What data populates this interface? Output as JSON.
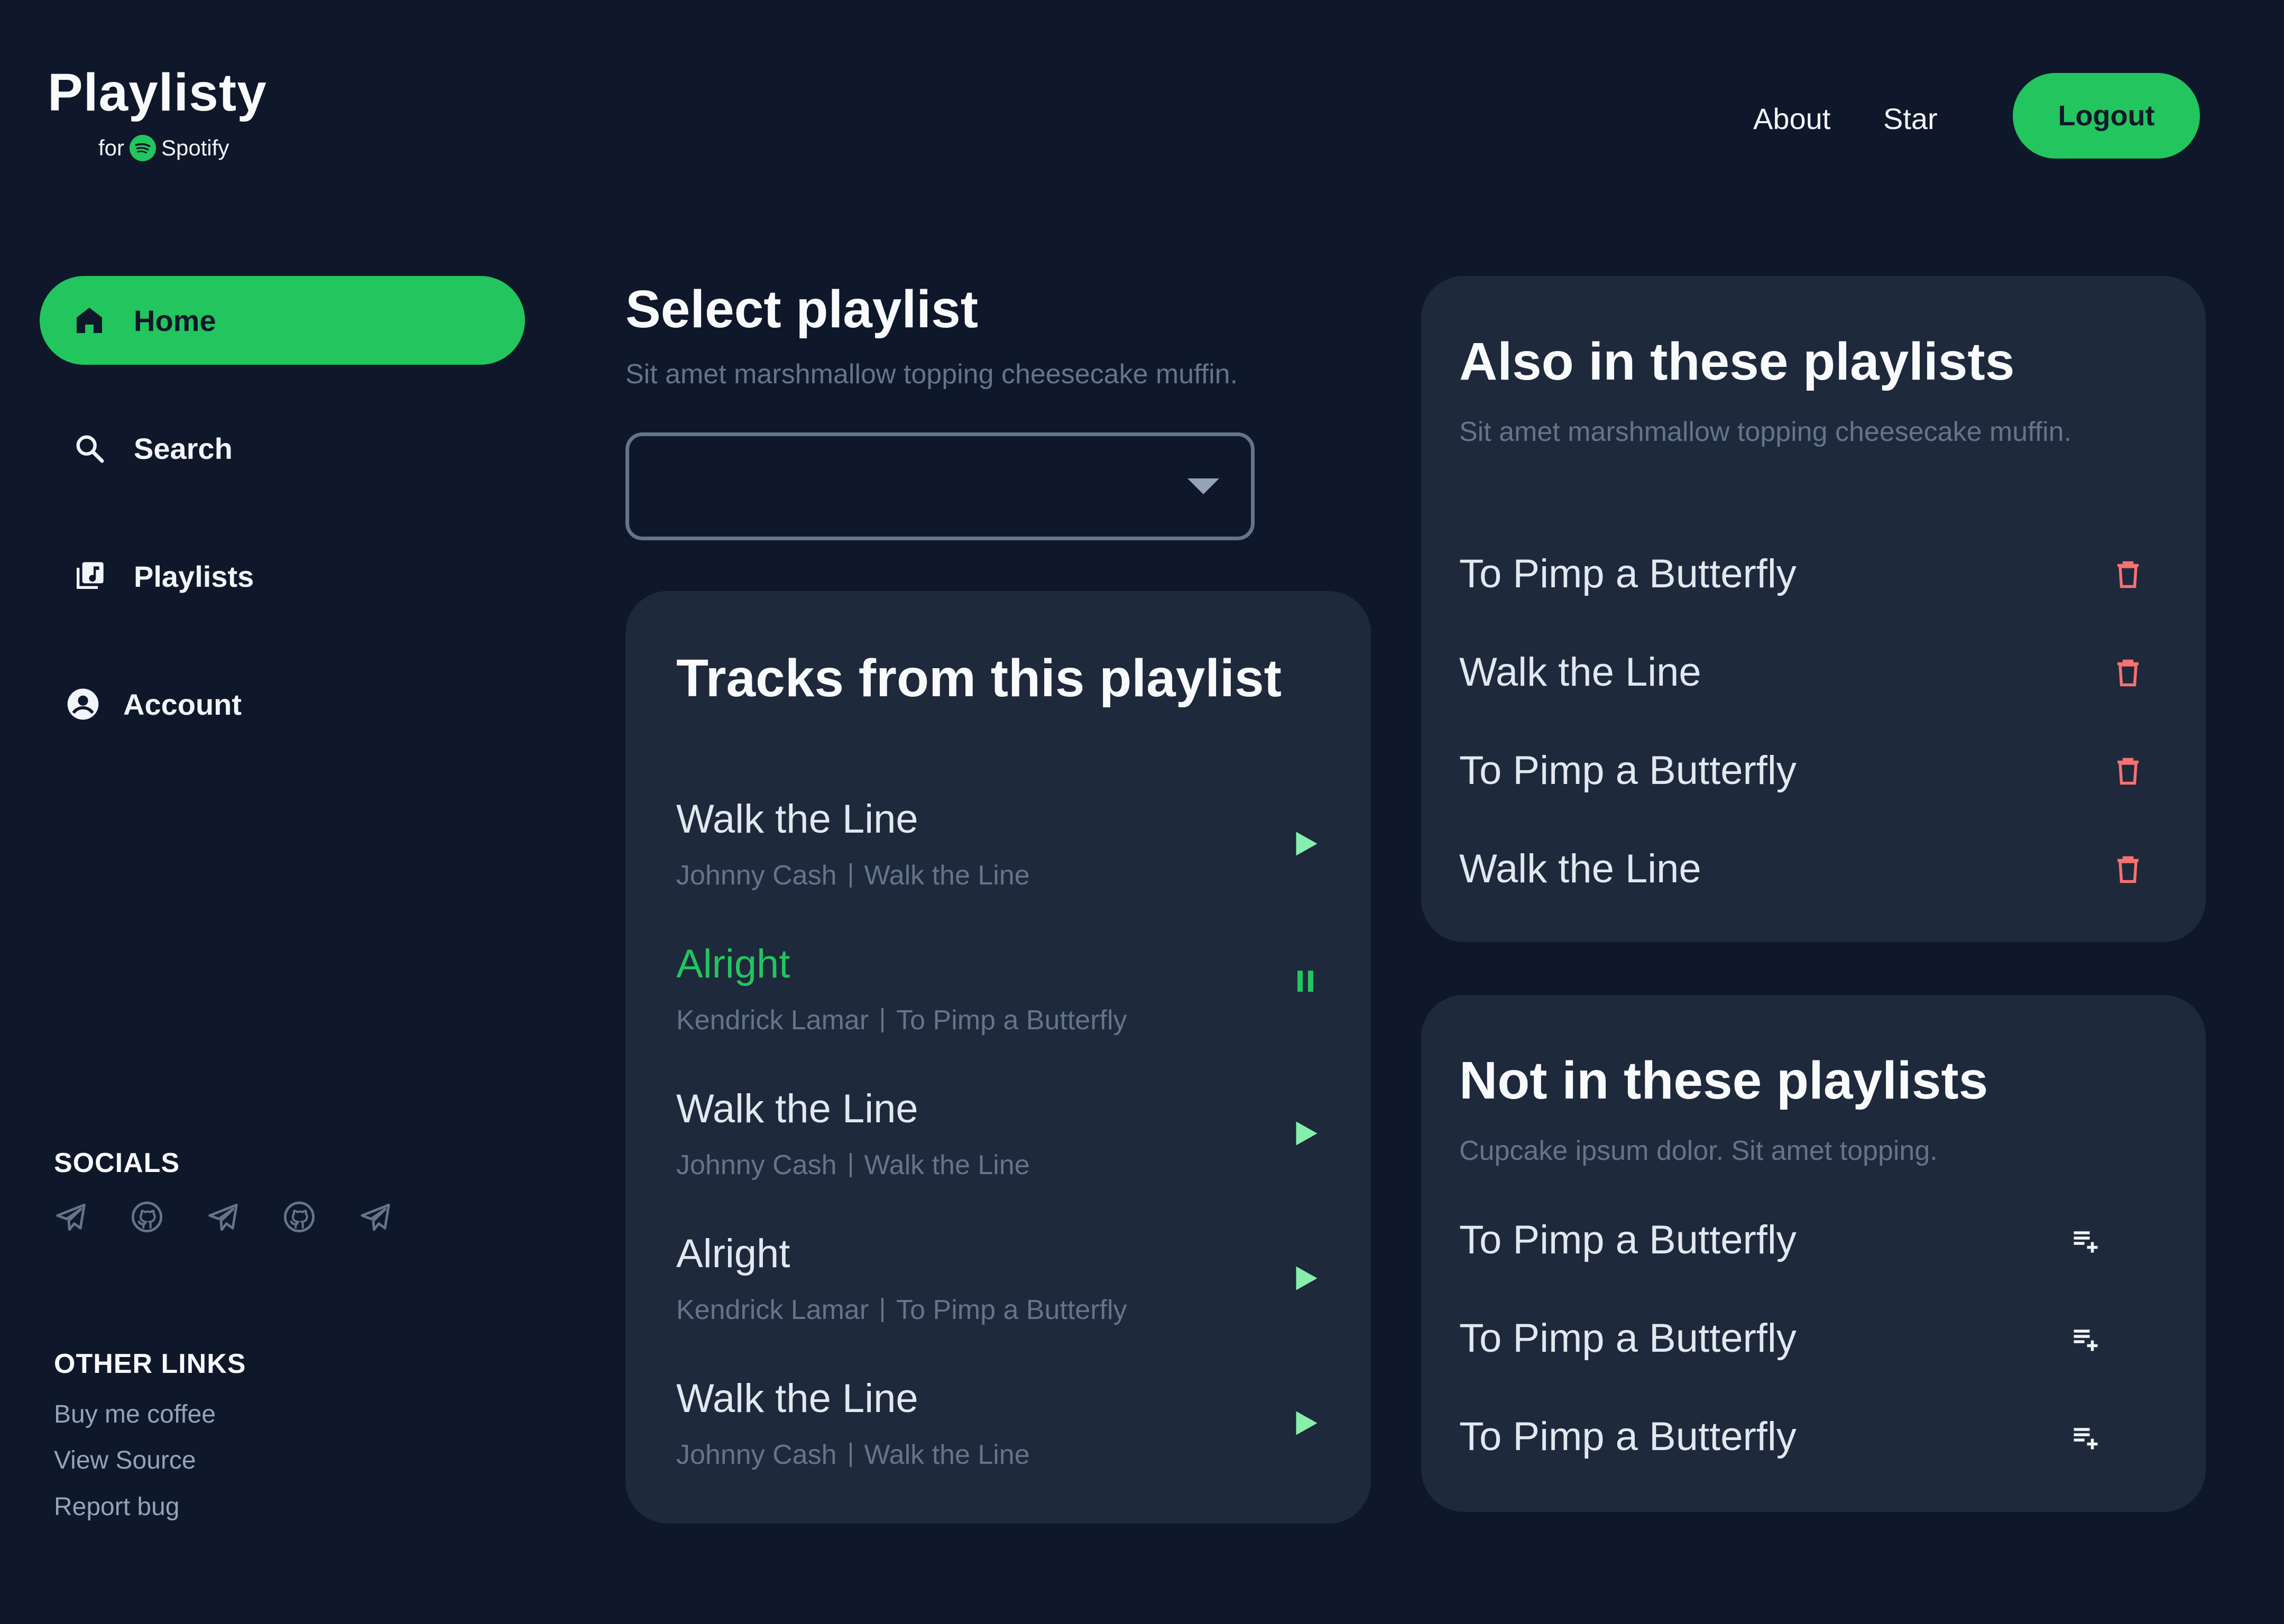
{
  "brand": {
    "title": "Playlisty",
    "for_label": "for",
    "spotify_label": "Spotify"
  },
  "topnav": {
    "about": "About",
    "star": "Star",
    "logout": "Logout"
  },
  "sidebar": {
    "items": [
      {
        "label": "Home",
        "icon": "home-icon",
        "active": true
      },
      {
        "label": "Search",
        "icon": "search-icon",
        "active": false
      },
      {
        "label": "Playlists",
        "icon": "library-music-icon",
        "active": false
      },
      {
        "label": "Account",
        "icon": "account-circle-icon",
        "active": false
      }
    ],
    "socials_title": "SOCIALS",
    "socials": [
      "telegram-icon",
      "github-icon",
      "telegram-icon",
      "github-icon",
      "telegram-icon"
    ],
    "other_links_title": "OTHER LINKS",
    "other_links": [
      "Buy me coffee",
      "View Source",
      "Report bug"
    ]
  },
  "select": {
    "title": "Select playlist",
    "subtitle": "Sit amet marshmallow topping cheesecake muffin.",
    "value": ""
  },
  "tracks": {
    "title": "Tracks from this playlist",
    "items": [
      {
        "title": "Walk the Line",
        "artist": "Johnny Cash",
        "album": "Walk the Line",
        "state": "play"
      },
      {
        "title": "Alright",
        "artist": "Kendrick Lamar",
        "album": "To Pimp a Butterfly",
        "state": "pause"
      },
      {
        "title": "Walk the Line",
        "artist": "Johnny Cash",
        "album": "Walk the Line",
        "state": "play"
      },
      {
        "title": "Alright",
        "artist": "Kendrick Lamar",
        "album": "To Pimp a Butterfly",
        "state": "play"
      },
      {
        "title": "Walk the Line",
        "artist": "Johnny Cash",
        "album": "Walk the Line",
        "state": "play"
      }
    ]
  },
  "also_in": {
    "title": "Also in these playlists",
    "subtitle": "Sit amet marshmallow topping cheesecake muffin.",
    "items": [
      "To Pimp a Butterfly",
      "Walk the Line",
      "To Pimp a Butterfly",
      "Walk the Line"
    ]
  },
  "not_in": {
    "title": "Not in these playlists",
    "subtitle": "Cupcake ipsum dolor. Sit amet topping.",
    "items": [
      "To Pimp a Butterfly",
      "To Pimp a Butterfly",
      "To Pimp a Butterfly"
    ]
  },
  "colors": {
    "background": "#0f172a",
    "card": "#1e293b",
    "accent": "#22c55e",
    "play": "#86efac",
    "delete": "#f87171",
    "muted": "#64748b"
  }
}
